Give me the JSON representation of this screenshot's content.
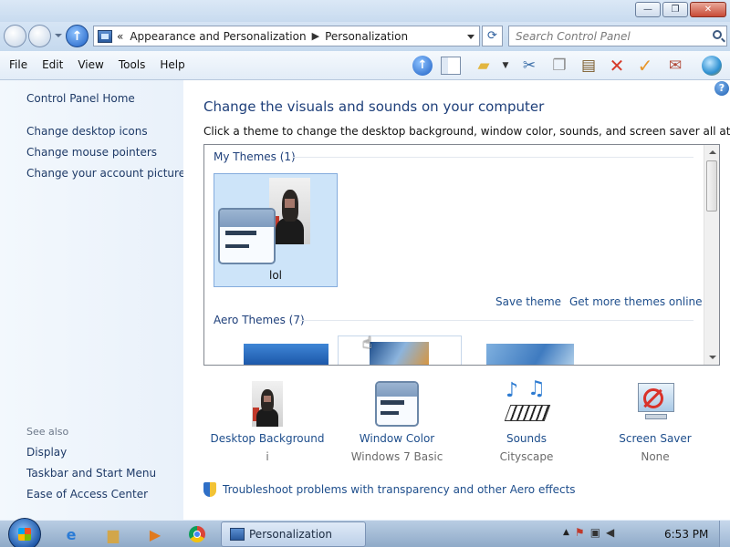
{
  "window": {
    "title_buttons": {
      "minimize": "—",
      "maximize": "❐",
      "close": "✕"
    }
  },
  "address_bar": {
    "prefix": "«",
    "crumbs": [
      "Appearance and Personalization",
      "Personalization"
    ],
    "search_placeholder": "Search Control Panel"
  },
  "menu": {
    "items": [
      "File",
      "Edit",
      "View",
      "Tools",
      "Help"
    ]
  },
  "sidebar": {
    "home": "Control Panel Home",
    "links": [
      "Change desktop icons",
      "Change mouse pointers",
      "Change your account picture"
    ],
    "see_also_label": "See also",
    "see_also": [
      "Display",
      "Taskbar and Start Menu",
      "Ease of Access Center"
    ]
  },
  "main": {
    "title": "Change the visuals and sounds on your computer",
    "description": "Click a theme to change the desktop background, window color, sounds, and screen saver all at once.",
    "help": "?"
  },
  "themes": {
    "my_themes_label": "My Themes (1)",
    "selected_theme_name": "lol",
    "save_theme": "Save theme",
    "get_more": "Get more themes online",
    "aero_label": "Aero Themes (7)"
  },
  "options": [
    {
      "label": "Desktop Background",
      "value": "i"
    },
    {
      "label": "Window Color",
      "value": "Windows 7 Basic"
    },
    {
      "label": "Sounds",
      "value": "Cityscape"
    },
    {
      "label": "Screen Saver",
      "value": "None"
    }
  ],
  "troubleshoot": "Troubleshoot problems with transparency and other Aero effects",
  "taskbar": {
    "active_window": "Personalization",
    "clock": "6:53 PM"
  },
  "colors": {
    "link": "#1e4e8c",
    "title": "#1e3f7a",
    "selection": "#cde4f9"
  }
}
